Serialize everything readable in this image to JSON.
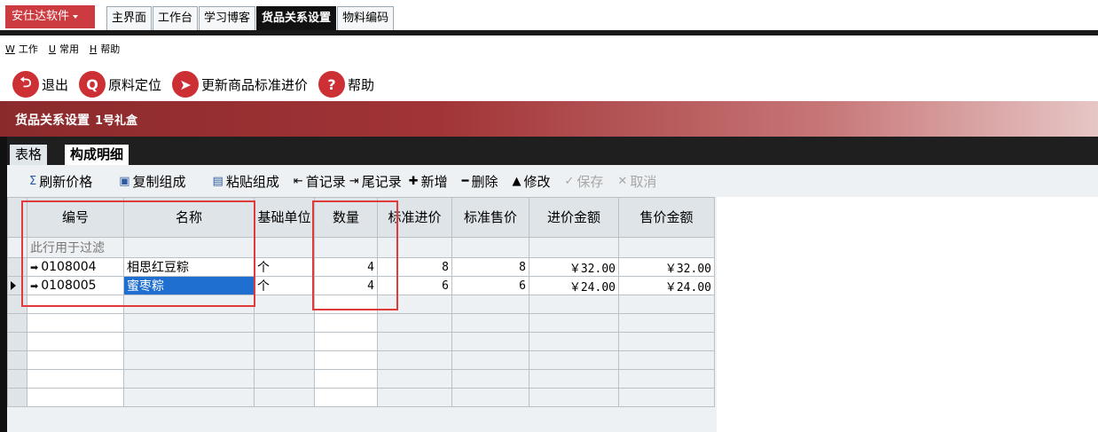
{
  "app": {
    "brand": "安仕达软件",
    "tabs": [
      "主界面",
      "工作台",
      "学习博客",
      "货品关系设置",
      "物料编码"
    ],
    "active_tab": "货品关系设置"
  },
  "menu": [
    {
      "key": "W",
      "label": "工作"
    },
    {
      "key": "U",
      "label": "常用"
    },
    {
      "key": "H",
      "label": "帮助"
    }
  ],
  "toolbar": [
    {
      "icon": "exit-icon",
      "label": "退出"
    },
    {
      "icon": "search-icon",
      "label": "原料定位"
    },
    {
      "icon": "send-icon",
      "label": "更新商品标准进价"
    },
    {
      "icon": "help-icon",
      "label": "帮助"
    }
  ],
  "title": {
    "main": "货品关系设置",
    "sub": "1号礼盒"
  },
  "subtabs": [
    "表格",
    "构成明细"
  ],
  "grid_toolbar": [
    {
      "icon": "sigma-icon",
      "label": "刷新价格",
      "enabled": true
    },
    {
      "icon": "copy-icon",
      "label": "复制组成",
      "enabled": true
    },
    {
      "icon": "paste-icon",
      "label": "粘贴组成",
      "enabled": true
    },
    {
      "icon": "first-record-icon",
      "label": "首记录",
      "enabled": true
    },
    {
      "icon": "last-record-icon",
      "label": "尾记录",
      "enabled": true
    },
    {
      "icon": "plus-icon",
      "label": "新增",
      "enabled": true
    },
    {
      "icon": "minus-icon",
      "label": "删除",
      "enabled": true
    },
    {
      "icon": "edit-icon",
      "label": "修改",
      "enabled": true
    },
    {
      "icon": "check-icon",
      "label": "保存",
      "enabled": false
    },
    {
      "icon": "cross-icon",
      "label": "取消",
      "enabled": false
    }
  ],
  "grid": {
    "columns": [
      "编号",
      "名称",
      "基础单位",
      "数量",
      "标准进价",
      "标准售价",
      "进价金额",
      "售价金额"
    ],
    "filter_hint": "此行用于过滤",
    "rows": [
      {
        "code": "0108004",
        "name": "相思红豆粽",
        "unit": "个",
        "qty": "4",
        "std_cost": "8",
        "std_price": "8",
        "cost_amt": "￥32.00",
        "price_amt": "￥32.00"
      },
      {
        "code": "0108005",
        "name": "蜜枣粽",
        "unit": "个",
        "qty": "4",
        "std_cost": "6",
        "std_price": "6",
        "cost_amt": "￥24.00",
        "price_amt": "￥24.00"
      }
    ],
    "selected_row": 1,
    "empty_rows": 6
  }
}
